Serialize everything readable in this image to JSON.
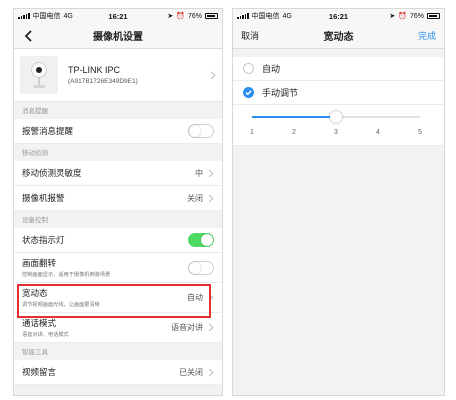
{
  "left": {
    "status": {
      "carrier": "中国电信",
      "network": "4G",
      "time": "16:21",
      "battery": "76%"
    },
    "nav": {
      "title": "摄像机设置"
    },
    "device": {
      "name": "TP-LINK IPC",
      "id": "(A917B1726E349D9E1)"
    },
    "sections": {
      "notify": "消息提醒",
      "motion": "移动侦测",
      "device_ctrl": "设备控制",
      "smart": "智能工具"
    },
    "rows": {
      "alarm_notify": {
        "label": "报警消息提醒",
        "on": false
      },
      "sensitivity": {
        "label": "移动侦测灵敏度",
        "value": "中"
      },
      "cam_alarm": {
        "label": "摄像机报警",
        "value": "关闭"
      },
      "status_led": {
        "label": "状态指示灯",
        "on": true
      },
      "flip": {
        "label": "画面翻转",
        "sub": "控制画面显示，适用于摄像机倒装场景",
        "on": false
      },
      "wdr": {
        "label": "宽动态",
        "sub": "调节视频画面光线，让画面更清晰",
        "value": "自动"
      },
      "talk": {
        "label": "通话模式",
        "sub": "语音对讲、电话模式",
        "value": "语音对讲"
      },
      "video_msg": {
        "label": "视频留言",
        "value": "已关闭"
      }
    }
  },
  "right": {
    "status": {
      "carrier": "中国电信",
      "network": "4G",
      "time": "16:21",
      "battery": "76%"
    },
    "nav": {
      "cancel": "取消",
      "title": "宽动态",
      "done": "完成"
    },
    "options": {
      "auto": "自动",
      "manual": "手动调节",
      "selected": "manual"
    },
    "slider": {
      "ticks": [
        "1",
        "2",
        "3",
        "4",
        "5"
      ],
      "value": 3
    }
  },
  "colors": {
    "accent": "#2a8ef0",
    "toggle_on": "#4cd964",
    "highlight": "#e03232"
  }
}
